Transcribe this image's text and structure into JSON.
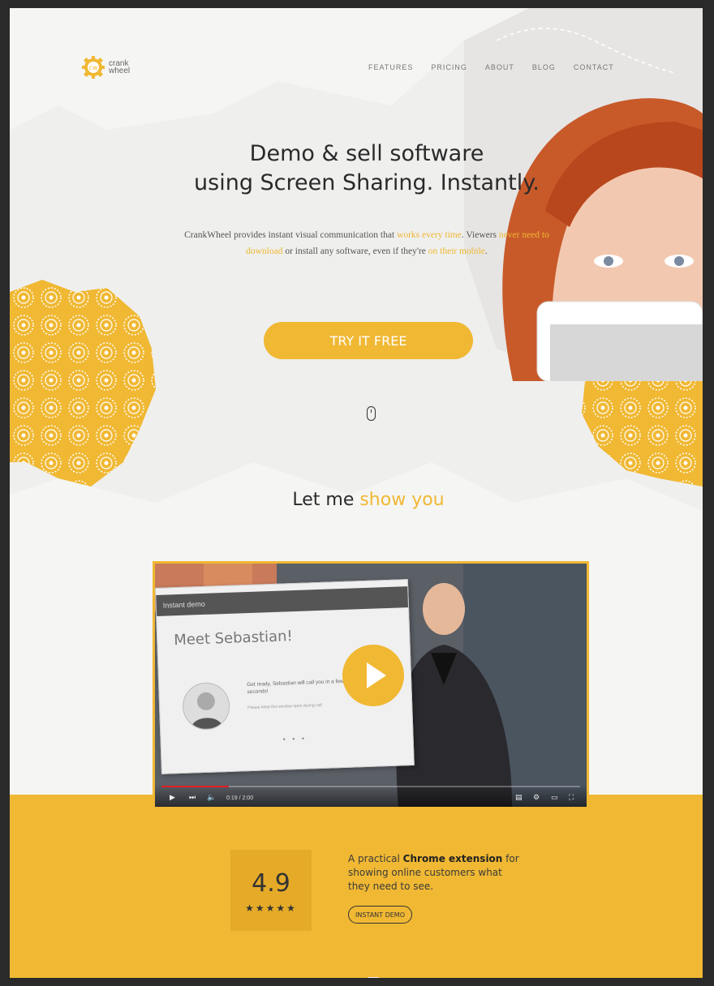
{
  "brand": {
    "name_line1": "crank",
    "name_line2": "wheel",
    "accent": "#f0b833",
    "logo_glyph": "cw",
    "logo_icon": "gear-logo-icon"
  },
  "nav": {
    "items": [
      "FEATURES",
      "PRICING",
      "ABOUT",
      "BLOG",
      "CONTACT"
    ]
  },
  "hero": {
    "title_line1": "Demo & sell software",
    "title_line2": "using Screen Sharing. Instantly.",
    "sub_a": "CrankWheel provides instant visual communication that ",
    "sub_b": "works every time",
    "sub_c": ". Viewers ",
    "sub_d": "never need to download",
    "sub_e": " or install any software, even if they're ",
    "sub_f": "on their mobile",
    "sub_g": ".",
    "cta_label": "TRY IT FREE",
    "scroll_icon": "mouse-scroll-icon"
  },
  "show": {
    "title_a": "Let me ",
    "title_b": "show you"
  },
  "video": {
    "card_header": "Instant demo",
    "meet_title": "Meet Sebastian!",
    "message": "Get ready, Sebastian will call you in a few seconds!",
    "message_note": "Please keep this window open during call",
    "dots": "• • •",
    "time": "0:19 / 2:00",
    "progress": 0.16,
    "play_icon": "play-icon"
  },
  "promo": {
    "rating": "4.9",
    "stars": "★★★★★",
    "text_a": "A practical ",
    "text_b": "Chrome extension",
    "text_c": " for showing online customers what they need to see.",
    "button_label": "INSTANT DEMO"
  }
}
